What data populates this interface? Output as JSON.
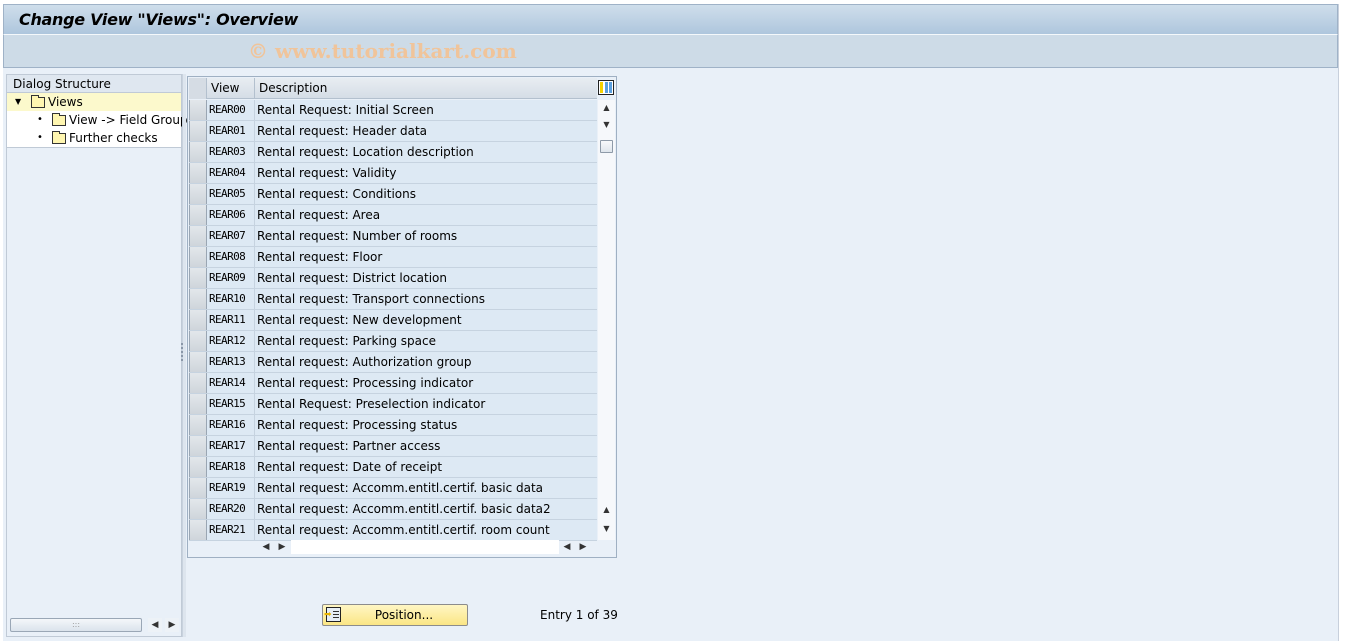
{
  "window": {
    "title": "Change View \"Views\": Overview",
    "watermark": "© www.tutorialkart.com"
  },
  "dialog_structure": {
    "header": "Dialog Structure",
    "items": [
      {
        "label": "Views",
        "level": 0,
        "expanded": true,
        "selected": true,
        "icon": "folder-open-icon"
      },
      {
        "label": "View -> Field Groups",
        "level": 1,
        "expanded": false,
        "selected": false,
        "icon": "folder-icon"
      },
      {
        "label": "Further checks",
        "level": 1,
        "expanded": false,
        "selected": false,
        "icon": "folder-icon"
      }
    ]
  },
  "table": {
    "columns": [
      "View",
      "Description"
    ],
    "settings_icon": "table-settings-icon",
    "rows": [
      {
        "view": "REAR00",
        "description": "Rental Request: Initial Screen"
      },
      {
        "view": "REAR01",
        "description": "Rental request: Header data"
      },
      {
        "view": "REAR03",
        "description": "Rental request: Location description"
      },
      {
        "view": "REAR04",
        "description": "Rental request: Validity"
      },
      {
        "view": "REAR05",
        "description": "Rental request: Conditions"
      },
      {
        "view": "REAR06",
        "description": "Rental request: Area"
      },
      {
        "view": "REAR07",
        "description": "Rental request: Number of rooms"
      },
      {
        "view": "REAR08",
        "description": "Rental request: Floor"
      },
      {
        "view": "REAR09",
        "description": "Rental request: District location"
      },
      {
        "view": "REAR10",
        "description": "Rental request: Transport connections"
      },
      {
        "view": "REAR11",
        "description": "Rental request: New development"
      },
      {
        "view": "REAR12",
        "description": "Rental request: Parking space"
      },
      {
        "view": "REAR13",
        "description": "Rental request: Authorization group"
      },
      {
        "view": "REAR14",
        "description": "Rental request: Processing indicator"
      },
      {
        "view": "REAR15",
        "description": "Rental Request: Preselection indicator"
      },
      {
        "view": "REAR16",
        "description": "Rental request: Processing status"
      },
      {
        "view": "REAR17",
        "description": "Rental request: Partner access"
      },
      {
        "view": "REAR18",
        "description": "Rental request: Date of receipt"
      },
      {
        "view": "REAR19",
        "description": "Rental request: Accomm.entitl.certif. basic data"
      },
      {
        "view": "REAR20",
        "description": "Rental request: Accomm.entitl.certif. basic data2"
      },
      {
        "view": "REAR21",
        "description": "Rental request: Accomm.entitl.certif. room count"
      }
    ]
  },
  "footer": {
    "position_button": "Position...",
    "entry_info": "Entry 1 of 39"
  }
}
